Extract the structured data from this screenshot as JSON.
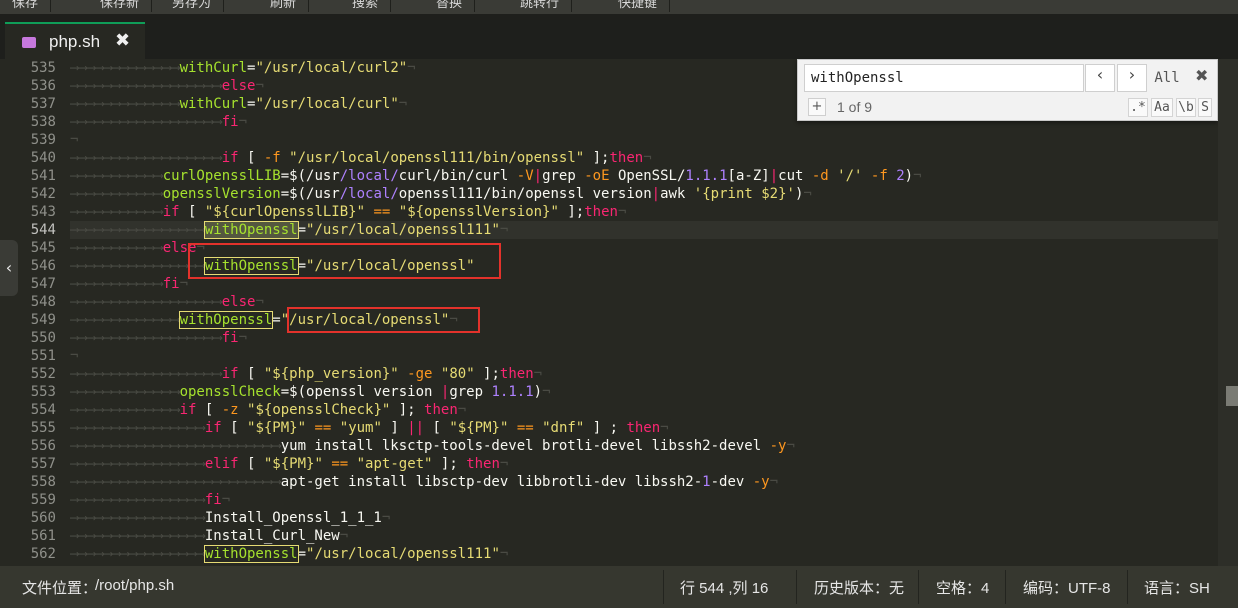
{
  "toolbar": {
    "items": [
      "保存",
      "保存新",
      "另存为",
      "刷新",
      "搜索",
      "替换",
      "跳转行",
      "快捷键"
    ]
  },
  "tab": {
    "filename": "php.sh",
    "close": "✖"
  },
  "find": {
    "value": "withOpenssl",
    "prev": "‹",
    "next": "›",
    "all": "All",
    "close": "✖",
    "add": "+",
    "count": "1 of 9",
    "regex": ".*",
    "case": "Aa",
    "word": "\\b",
    "selection": "S"
  },
  "editor": {
    "line_numbers": [
      "535",
      "536",
      "537",
      "538",
      "539",
      "540",
      "541",
      "542",
      "543",
      "544",
      "545",
      "546",
      "547",
      "548",
      "549",
      "550",
      "551",
      "552",
      "553",
      "554",
      "555",
      "556",
      "557",
      "558",
      "559",
      "560",
      "561",
      "562"
    ],
    "current_line": "544"
  },
  "statusbar": {
    "path_label": "文件位置：",
    "path": "/root/php.sh",
    "cursor": "行 544 ,列 16",
    "history": "历史版本：无",
    "indent": "空格：4",
    "encoding": "编码：UTF-8",
    "language": "语言：SH"
  },
  "colors": {
    "background": "#272822",
    "keyword": "#f92672",
    "string": "#e6db74",
    "variable": "#a6e22e",
    "number": "#ae81ff",
    "annotation": "#e3322b"
  }
}
